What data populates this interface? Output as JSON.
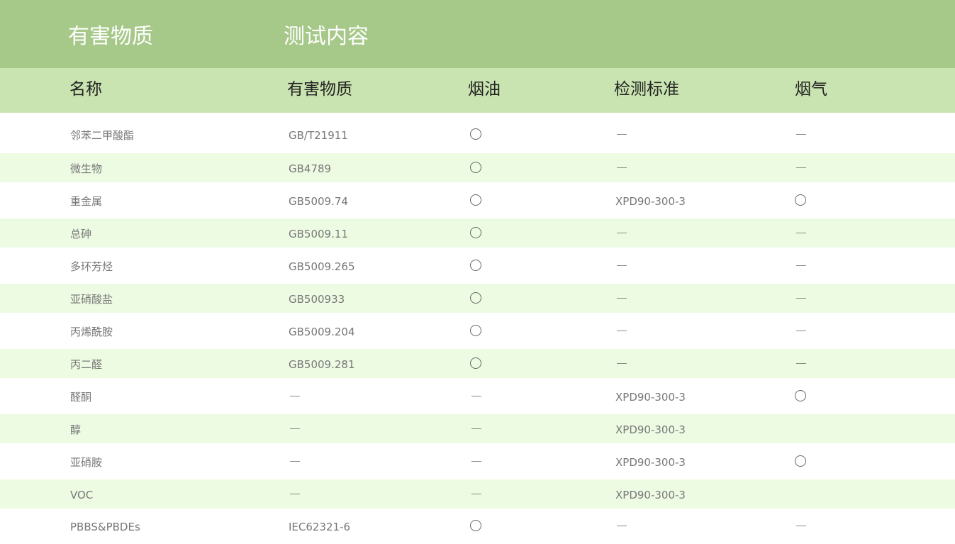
{
  "top_header": {
    "col1": "有害物质",
    "col2": "测试内容"
  },
  "columns": [
    "名称",
    "有害物质",
    "烟油",
    "检测标准",
    "烟气"
  ],
  "rows": [
    {
      "name": "邻苯二甲酸酯",
      "substance": "GB/T21911",
      "oil": "circle",
      "standard": "dash",
      "smoke": "dash"
    },
    {
      "name": "微生物",
      "substance": "GB4789",
      "oil": "circle",
      "standard": "dash",
      "smoke": "dash"
    },
    {
      "name": "重金属",
      "substance": "GB5009.74",
      "oil": "circle",
      "standard": "XPD90-300-3",
      "smoke": "circle"
    },
    {
      "name": "总砷",
      "substance": "GB5009.11",
      "oil": "circle",
      "standard": "dash",
      "smoke": "dash"
    },
    {
      "name": "多环芳烃",
      "substance": "GB5009.265",
      "oil": "circle",
      "standard": "dash",
      "smoke": "dash"
    },
    {
      "name": "亚硝酸盐",
      "substance": "GB500933",
      "oil": "circle",
      "standard": "dash",
      "smoke": "dash"
    },
    {
      "name": "丙烯酰胺",
      "substance": "GB5009.204",
      "oil": "circle",
      "standard": "dash",
      "smoke": "dash"
    },
    {
      "name": "丙二醛",
      "substance": "GB5009.281",
      "oil": "circle",
      "standard": "dash",
      "smoke": "dash"
    },
    {
      "name": "醛酮",
      "substance": "dash",
      "oil": "dash",
      "standard": "XPD90-300-3",
      "smoke": "circle"
    },
    {
      "name": "醇",
      "substance": "dash",
      "oil": "dash",
      "standard": "XPD90-300-3",
      "smoke": ""
    },
    {
      "name": "亚硝胺",
      "substance": "dash",
      "oil": "dash",
      "standard": "XPD90-300-3",
      "smoke": "circle"
    },
    {
      "name": "VOC",
      "substance": "dash",
      "oil": "dash",
      "standard": "XPD90-300-3",
      "smoke": ""
    },
    {
      "name": "PBBS&PBDEs",
      "substance": "IEC62321-6",
      "oil": "circle",
      "standard": "dash",
      "smoke": "dash"
    }
  ]
}
